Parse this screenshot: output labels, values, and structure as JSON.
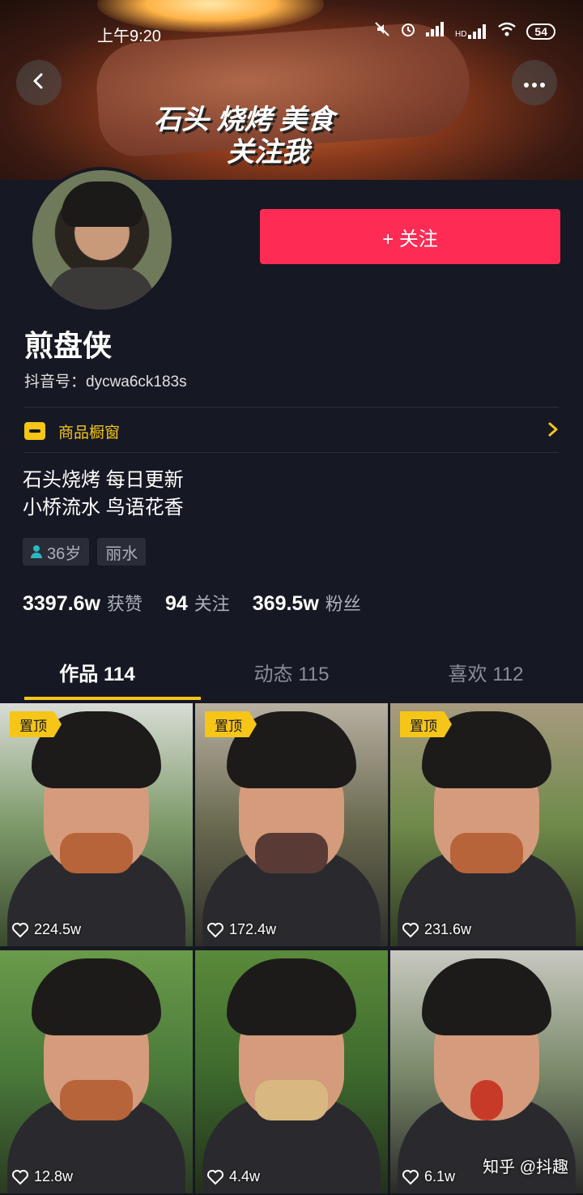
{
  "status_bar": {
    "time": "上午9:20",
    "battery": "54",
    "network_label": "HD"
  },
  "header": {
    "banner_line1": "石头 烧烤 美食",
    "banner_line2": "关注我"
  },
  "profile": {
    "follow_label": "+ 关注",
    "name": "煎盘侠",
    "douyin_id": "抖音号：dycwa6ck183s",
    "shop_label": "商品橱窗",
    "bio_line1": "石头烧烤  每日更新",
    "bio_line2": "小桥流水  鸟语花香",
    "tags": {
      "age": "36岁",
      "location": "丽水"
    },
    "stats": [
      {
        "value": "3397.6w",
        "label": "获赞"
      },
      {
        "value": "94",
        "label": "关注"
      },
      {
        "value": "369.5w",
        "label": "粉丝"
      }
    ]
  },
  "tabs": [
    {
      "label": "作品 114",
      "active": true
    },
    {
      "label": "动态 115",
      "active": false
    },
    {
      "label": "喜欢 112",
      "active": false
    }
  ],
  "videos": [
    {
      "pinned": "置顶",
      "likes": "224.5w"
    },
    {
      "pinned": "置顶",
      "likes": "172.4w"
    },
    {
      "pinned": "置顶",
      "likes": "231.6w"
    },
    {
      "pinned": "",
      "likes": "12.8w"
    },
    {
      "pinned": "",
      "likes": "4.4w"
    },
    {
      "pinned": "",
      "likes": "6.1w"
    }
  ],
  "watermark": "知乎 @抖趣",
  "colors": {
    "background": "#161823",
    "follow": "#fe2c55",
    "accent": "#f5c518"
  }
}
